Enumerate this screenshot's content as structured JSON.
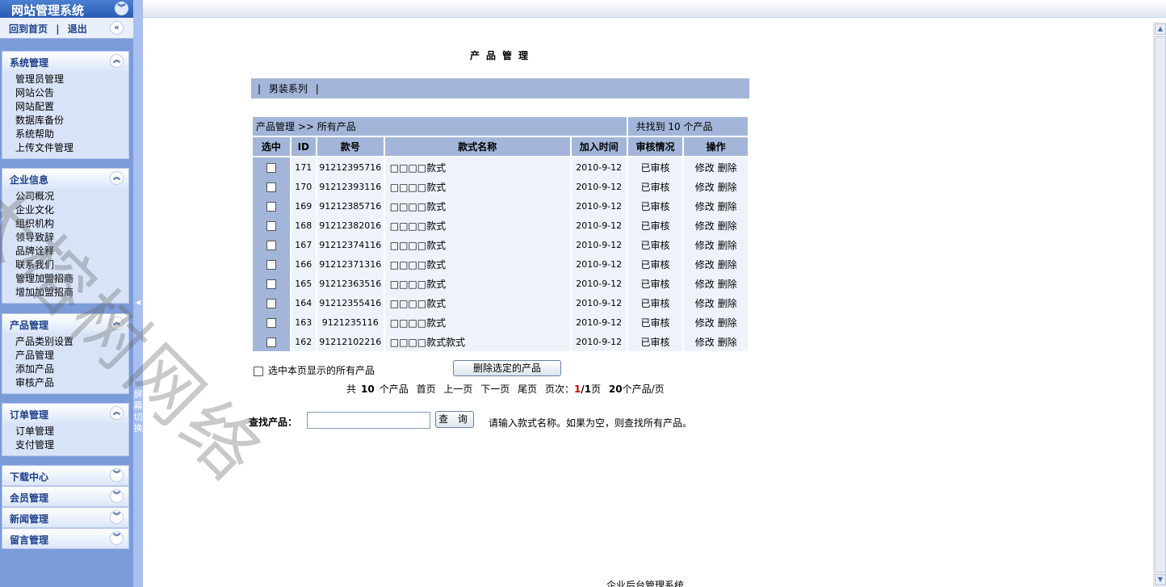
{
  "sidebar": {
    "title": "网站管理系统",
    "home_link": "回到首页",
    "separator": "|",
    "logout_link": "退出",
    "groups": [
      {
        "title": "系统管理",
        "items": [
          "管理员管理",
          "网站公告",
          "网站配置",
          "数据库备份",
          "系统帮助",
          "上传文件管理"
        ]
      },
      {
        "title": "企业信息",
        "items": [
          "公司概况",
          "企业文化",
          "组织机构",
          "领导致辞",
          "品牌诠释",
          "联系我们",
          "管理加盟招商",
          "增加加盟招商"
        ]
      },
      {
        "title": "产品管理",
        "items": [
          "产品类别设置",
          "产品管理",
          "添加产品",
          "审核产品"
        ]
      },
      {
        "title": "订单管理",
        "items": [
          "订单管理",
          "支付管理"
        ]
      },
      {
        "title": "下载中心",
        "items": []
      },
      {
        "title": "会员管理",
        "items": []
      },
      {
        "title": "新闻管理",
        "items": []
      },
      {
        "title": "留言管理",
        "items": []
      }
    ],
    "screen_switch": "屏幕切换"
  },
  "main": {
    "page_title": "产品管理",
    "category_bar": [
      "|",
      "男装系列",
      "|"
    ],
    "breadcrumb": "产品管理 >> 所有产品",
    "found_text": "共找到 10 个产品",
    "columns": [
      "选中",
      "ID",
      "款号",
      "款式名称",
      "加入时间",
      "审核情况",
      "操作"
    ],
    "rows": [
      {
        "id": "171",
        "code": "91212395716",
        "name": "□□□□款式",
        "date": "2010-9-12",
        "status": "已审核",
        "edit": "修改",
        "delete": "删除"
      },
      {
        "id": "170",
        "code": "91212393116",
        "name": "□□□□款式",
        "date": "2010-9-12",
        "status": "已审核",
        "edit": "修改",
        "delete": "删除"
      },
      {
        "id": "169",
        "code": "91212385716",
        "name": "□□□□款式",
        "date": "2010-9-12",
        "status": "已审核",
        "edit": "修改",
        "delete": "删除"
      },
      {
        "id": "168",
        "code": "91212382016",
        "name": "□□□□款式",
        "date": "2010-9-12",
        "status": "已审核",
        "edit": "修改",
        "delete": "删除"
      },
      {
        "id": "167",
        "code": "91212374116",
        "name": "□□□□款式",
        "date": "2010-9-12",
        "status": "已审核",
        "edit": "修改",
        "delete": "删除"
      },
      {
        "id": "166",
        "code": "91212371316",
        "name": "□□□□款式",
        "date": "2010-9-12",
        "status": "已审核",
        "edit": "修改",
        "delete": "删除"
      },
      {
        "id": "165",
        "code": "91212363516",
        "name": "□□□□款式",
        "date": "2010-9-12",
        "status": "已审核",
        "edit": "修改",
        "delete": "删除"
      },
      {
        "id": "164",
        "code": "91212355416",
        "name": "□□□□款式",
        "date": "2010-9-12",
        "status": "已审核",
        "edit": "修改",
        "delete": "删除"
      },
      {
        "id": "163",
        "code": "9121235116",
        "name": "□□□□款式",
        "date": "2010-9-12",
        "status": "已审核",
        "edit": "修改",
        "delete": "删除"
      },
      {
        "id": "162",
        "code": "91212102216",
        "name": "□□□□款式款式",
        "date": "2010-9-12",
        "status": "已审核",
        "edit": "修改",
        "delete": "删除"
      }
    ],
    "select_all_label": "选中本页显示的所有产品",
    "delete_button": "删除选定的产品",
    "pager": {
      "total_prefix": "共",
      "total": "10",
      "total_suffix": "个产品",
      "first": "首页",
      "prev": "上一页",
      "next": "下一页",
      "last": "尾页",
      "page_label": "页次：",
      "current_page": "1",
      "page_sep": "/",
      "total_pages": "1",
      "page_unit": "页",
      "per_page": "20",
      "per_page_suffix": "个产品/页"
    },
    "search": {
      "label": "查找产品：",
      "value": "",
      "button": "查 询",
      "hint": "请输入款式名称。如果为空，则查找所有产品。"
    },
    "footer": "企业后台管理系统"
  },
  "watermark": "大榕树网络",
  "colors": {
    "sidebar_bg": "#7b9bd9",
    "header_cell": "#a3b6d9",
    "row_bg": "#eef3fb",
    "accent_red": "#cc0000"
  }
}
